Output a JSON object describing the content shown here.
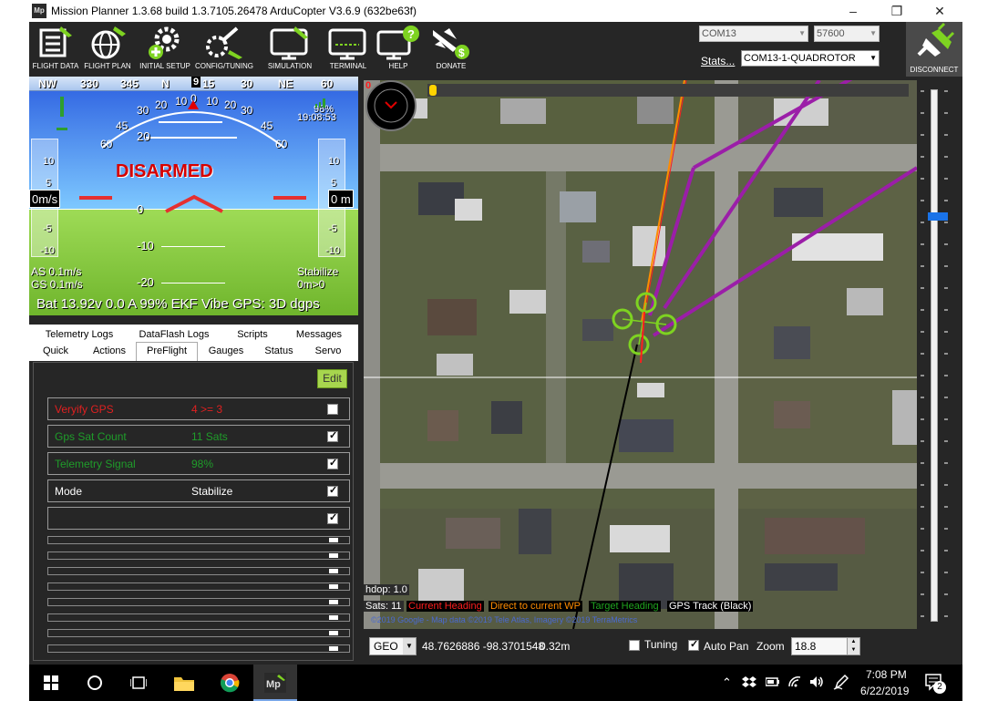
{
  "window": {
    "logo": "Mp",
    "title": "Mission Planner 1.3.68 build 1.3.7105.26478 ArduCopter V3.6.9 (632be63f)"
  },
  "toolbar": {
    "buttons": [
      {
        "label": "FLIGHT DATA",
        "icon": "monitor-plane-icon"
      },
      {
        "label": "FLIGHT PLAN",
        "icon": "globe-icon"
      },
      {
        "label": "INITIAL SETUP",
        "icon": "gears-plus-icon"
      },
      {
        "label": "CONFIG/TUNING",
        "icon": "wrench-plane-icon"
      },
      {
        "label": "SIMULATION",
        "icon": "monitor-sim-icon"
      },
      {
        "label": "TERMINAL",
        "icon": "terminal-icon"
      },
      {
        "label": "HELP",
        "icon": "help-monitor-icon"
      },
      {
        "label": "DONATE",
        "icon": "plane-dollar-icon"
      }
    ],
    "port": "COM13",
    "baud": "57600",
    "stats_link": "Stats...",
    "connection": "COM13-1-QUADROTOR",
    "disconnect_label": "DISCONNECT"
  },
  "hud": {
    "heading_marks": [
      "NW",
      "330",
      "345",
      "N",
      "15",
      "30",
      "NE",
      "60"
    ],
    "heading_readout": "9",
    "roll_marks": [
      "60",
      "45",
      "30",
      "20",
      "10",
      "0",
      "10",
      "20",
      "30",
      "45",
      "60"
    ],
    "pitch_marks": [
      "20",
      "0",
      "-10",
      "-20"
    ],
    "speed_tape": [
      "10",
      "5",
      "-5",
      "-10"
    ],
    "alt_tape": [
      "10",
      "5",
      "-5",
      "-10"
    ],
    "battery_pct": "98%",
    "clock": "19:08:53",
    "status": "DISARMED",
    "speed": "0m/s",
    "altitude": "0 m",
    "airspeed": "AS 0.1m/s",
    "groundspeed": "GS 0.1m/s",
    "mode": "Stabilize",
    "wp": "0m>0",
    "bottom_line": "Bat 13.92v 0.0 A 99%   EKF  Vibe  GPS: 3D dgps"
  },
  "tabs": {
    "row1": [
      "Telemetry Logs",
      "DataFlash Logs",
      "Scripts",
      "Messages"
    ],
    "row2": [
      "Quick",
      "Actions",
      "PreFlight",
      "Gauges",
      "Status",
      "Servo"
    ],
    "active": "PreFlight"
  },
  "preflight": {
    "edit_label": "Edit",
    "checks": [
      {
        "label": "Veryify GPS",
        "value": "4 >= 3",
        "color": "#e02020",
        "checked": false
      },
      {
        "label": "Gps Sat Count",
        "value": "11 Sats",
        "color": "#1f9d2a",
        "checked": true
      },
      {
        "label": "Telemetry Signal",
        "value": "98%",
        "color": "#1f9d2a",
        "checked": true
      },
      {
        "label": "Mode",
        "value": "Stabilize",
        "color": "#ffffff",
        "checked": true
      },
      {
        "label": "",
        "value": "",
        "color": "#ffffff",
        "checked": true
      }
    ]
  },
  "map": {
    "heading_value": "0",
    "hdop": "hdop: 1.0",
    "sats": "Sats: 11",
    "legend": [
      {
        "label": "Current Heading",
        "color": "#ff1e1e"
      },
      {
        "label": "Direct to current WP",
        "color": "#ff8c00"
      },
      {
        "label": "Target Heading",
        "color": "#1fa31f"
      },
      {
        "label": "GPS Track (Black)",
        "color": "#ffffff"
      }
    ],
    "copyright": "©2019 Google - Map data ©2019 Tele Atlas, Imagery ©2019 TerraMetrics"
  },
  "statusbar": {
    "coord_type": "GEO",
    "coords": "48.7626886 -98.3701548",
    "distance": "0.32m",
    "tuning_label": "Tuning",
    "tuning_checked": false,
    "autopan_label": "Auto Pan",
    "autopan_checked": true,
    "zoom_label": "Zoom",
    "zoom_value": "18.8"
  },
  "taskbar": {
    "time": "7:08 PM",
    "date": "6/22/2019",
    "notifications": "2"
  }
}
